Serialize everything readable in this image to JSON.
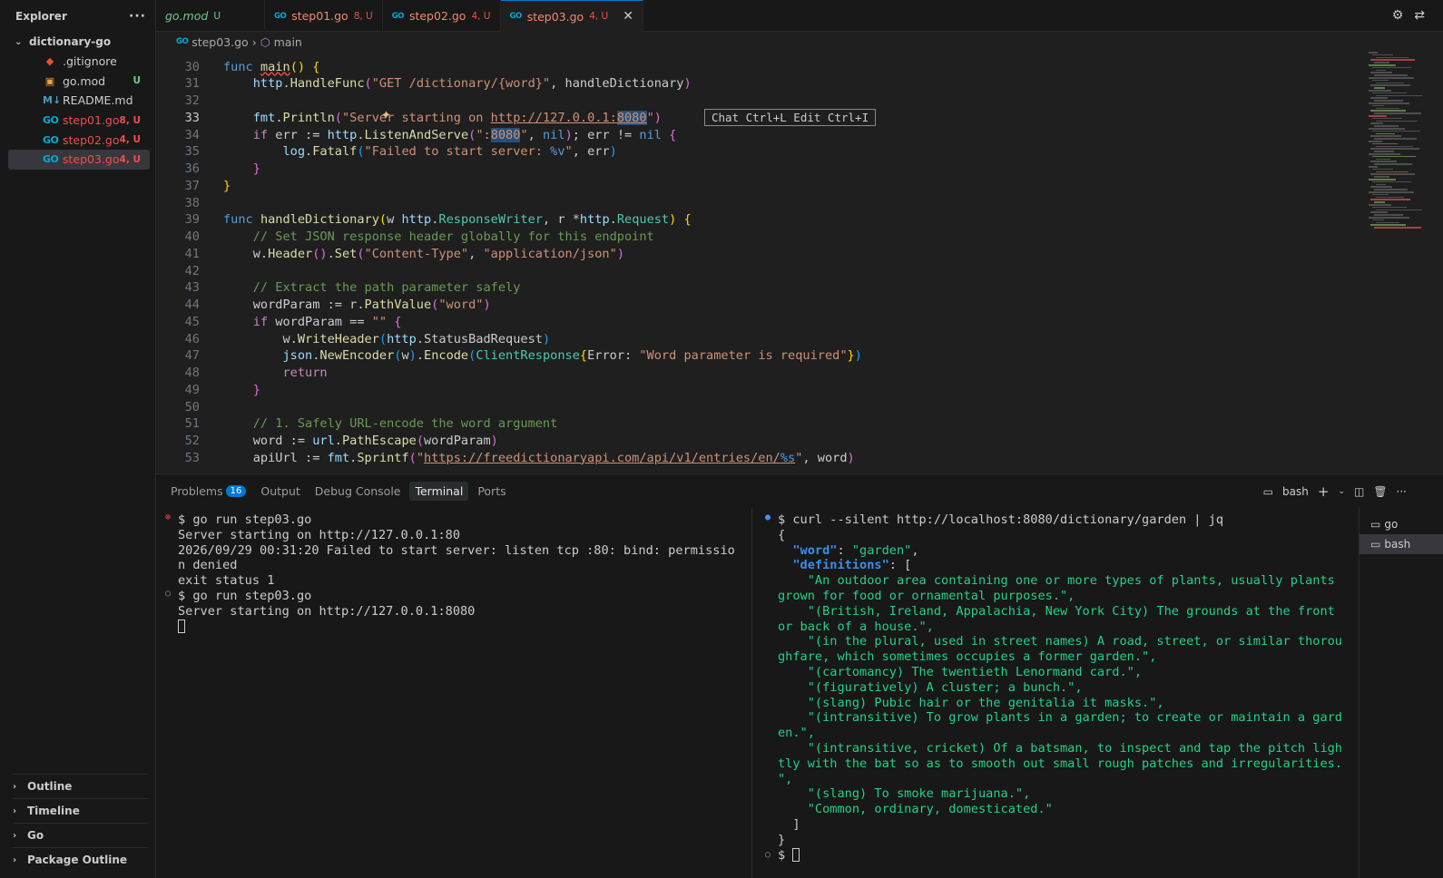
{
  "sidebar": {
    "title": "Explorer",
    "more": "···",
    "folder": "dictionary-go",
    "files": [
      {
        "name": ".gitignore",
        "badge": "",
        "icon": "git-icon",
        "glyph": "◆",
        "cls": "",
        "badgecls": ""
      },
      {
        "name": "go.mod",
        "badge": "U",
        "icon": "go-mod-icon",
        "glyph": "▣",
        "cls": "",
        "badgecls": "status-u"
      },
      {
        "name": "README.md",
        "badge": "",
        "icon": "markdown-icon",
        "glyph": "M↓",
        "cls": "",
        "badgecls": ""
      },
      {
        "name": "step01.go",
        "badge": "8, U",
        "icon": "go-file-icon",
        "glyph": "GO",
        "cls": "status-err",
        "badgecls": "status-err"
      },
      {
        "name": "step02.go",
        "badge": "4, U",
        "icon": "go-file-icon",
        "glyph": "GO",
        "cls": "status-err",
        "badgecls": "status-err"
      },
      {
        "name": "step03.go",
        "badge": "4, U",
        "icon": "go-file-icon",
        "glyph": "GO",
        "cls": "status-err",
        "badgecls": "status-err"
      }
    ],
    "sections": [
      "Outline",
      "Timeline",
      "Go",
      "Package Outline"
    ]
  },
  "tabs": [
    {
      "label": "go.mod",
      "badge": "U",
      "kind": "mod"
    },
    {
      "label": "step01.go",
      "badge": "8, U",
      "kind": "err"
    },
    {
      "label": "step02.go",
      "badge": "4, U",
      "kind": "err"
    },
    {
      "label": "step03.go",
      "badge": "4, U",
      "kind": "err",
      "active": true
    }
  ],
  "breadcrumb": {
    "file": "step03.go",
    "symbol": "main"
  },
  "editor": {
    "chat_hint": "Chat Ctrl+L Edit Ctrl+I",
    "line_numbers": [
      "30",
      "31",
      "32",
      "33",
      "34",
      "35",
      "36",
      "37",
      "38",
      "39",
      "40",
      "41",
      "42",
      "43",
      "44",
      "45",
      "46",
      "47",
      "48",
      "49",
      "50",
      "51",
      "52",
      "53"
    ]
  },
  "panel": {
    "tabs": [
      "Problems",
      "Output",
      "Debug Console",
      "Terminal",
      "Ports"
    ],
    "problems_count": "16",
    "shell": "bash",
    "left_terminal": [
      "$ go run step03.go",
      "Server starting on http://127.0.0.1:80",
      "2026/09/29 00:31:20 Failed to start server: listen tcp :80: bind: permissio",
      "n denied",
      "exit status 1",
      "$ go run step03.go",
      "Server starting on http://127.0.0.1:8080"
    ],
    "right_terminal": {
      "command": "$ curl --silent http://localhost:8080/dictionary/garden | jq",
      "word_key": "\"word\"",
      "word_val": "\"garden\"",
      "defs_key": "\"definitions\"",
      "definitions": [
        "    \"An outdoor area containing one or more types of plants, usually plants",
        "grown for food or ornamental purposes.\",",
        "    \"(British, Ireland, Appalachia, New York City) The grounds at the front",
        "or back of a house.\",",
        "    \"(in the plural, used in street names) A road, street, or similar thorou",
        "ghfare, which sometimes occupies a former garden.\",",
        "    \"(cartomancy) The twentieth Lenormand card.\",",
        "    \"(figuratively) A cluster; a bunch.\",",
        "    \"(slang) Pubic hair or the genitalia it masks.\",",
        "    \"(intransitive) To grow plants in a garden; to create or maintain a gard",
        "en.\",",
        "    \"(intransitive, cricket) Of a batsman, to inspect and tap the pitch ligh",
        "tly with the bat so as to smooth out small rough patches and irregularities.",
        "\",",
        "    \"(slang) To smoke marijuana.\",",
        "    \"Common, ordinary, domesticated.\""
      ],
      "prompt": "$"
    },
    "terminal_list": [
      "go",
      "bash"
    ]
  }
}
